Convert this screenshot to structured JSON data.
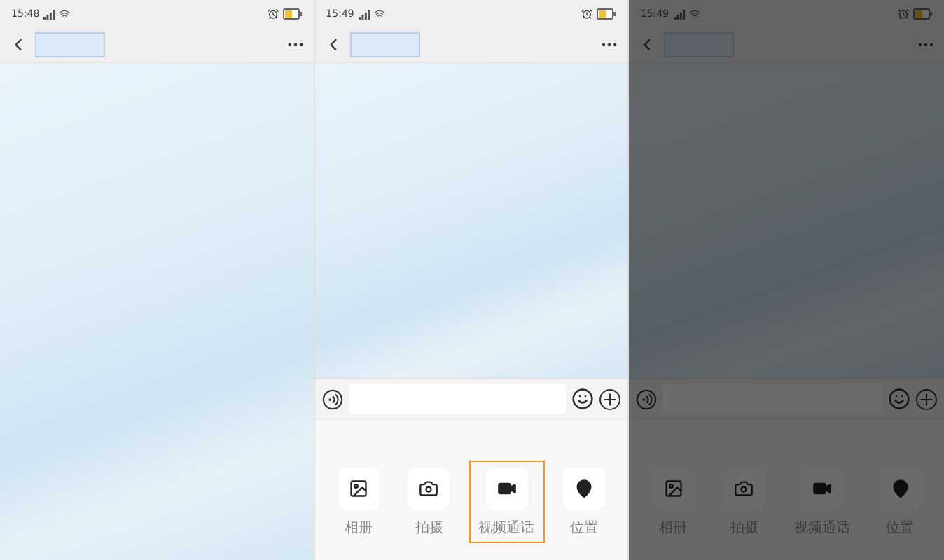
{
  "screens": [
    {
      "time": "15:48",
      "dimmed": false
    },
    {
      "time": "15:49",
      "dimmed": false,
      "composer": {
        "actions": [
          {
            "kind": "album",
            "label": "相册",
            "highlighted": false
          },
          {
            "kind": "camera",
            "label": "拍摄",
            "highlighted": false
          },
          {
            "kind": "video",
            "label": "视频通话",
            "highlighted": true
          },
          {
            "kind": "location",
            "label": "位置",
            "highlighted": false
          }
        ]
      }
    },
    {
      "time": "15:49",
      "dimmed": true,
      "composer": {
        "actions": [
          {
            "kind": "album",
            "label": "相册",
            "highlighted": false
          },
          {
            "kind": "camera",
            "label": "拍摄",
            "highlighted": false
          },
          {
            "kind": "video",
            "label": "视频通话",
            "highlighted": false
          },
          {
            "kind": "location",
            "label": "位置",
            "highlighted": false
          }
        ]
      }
    }
  ]
}
